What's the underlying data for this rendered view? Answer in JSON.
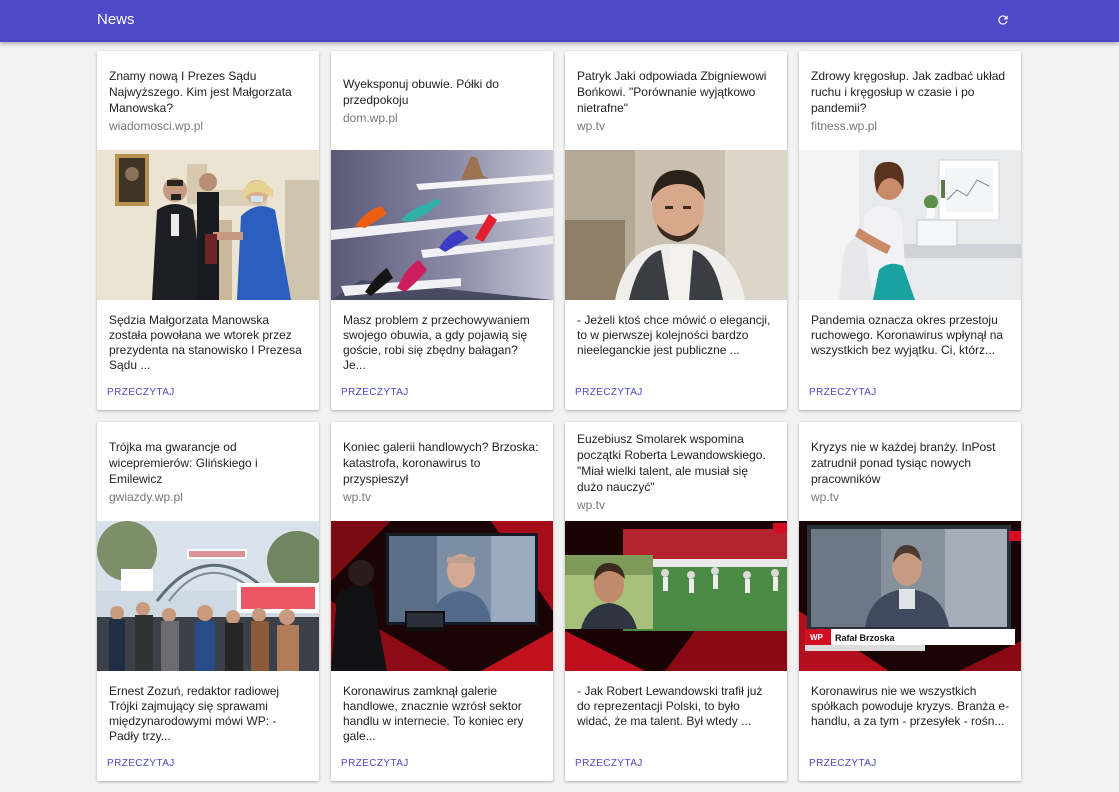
{
  "appbar": {
    "title": "News",
    "refresh_icon": "refresh-icon",
    "color": "#4e49c6"
  },
  "cards": [
    {
      "title": "Znamy nową I Prezes Sądu Najwyższego. Kim jest Małgorzata Manowska?",
      "source": "wiadomosci.wp.pl",
      "description": "Sędzia Małgorzata Manowska została powołana we wtorek przez prezydenta na stanowisko I Prezesa Sądu ...",
      "action": "PRZECZYTAJ",
      "image": "two-people-handshake-photo"
    },
    {
      "title": "Wyeksponuj obuwie. Półki do przedpokoju",
      "source": "dom.wp.pl",
      "description": "Masz problem z przechowywaniem swojego obuwia, a gdy pojawią się goście, robi się zbędny bałagan? Je...",
      "action": "PRZECZYTAJ",
      "image": "shoes-on-shelves-photo"
    },
    {
      "title": "Patryk Jaki odpowiada Zbigniewowi Bońkowi. \"Porównanie wyjątkowo nietrafne\"",
      "source": "wp.tv",
      "description": "- Jeżeli ktoś chce mówić o elegancji, to w pierwszej kolejności bardzo nieeleganckie jest publiczne ...",
      "action": "PRZECZYTAJ",
      "image": "man-interview-photo"
    },
    {
      "title": "Zdrowy kręgosłup. Jak zadbać układ ruchu i kręgosłup w czasie i po pandemii?",
      "source": "fitness.wp.pl",
      "description": "Pandemia oznacza okres przestoju ruchowego. Koronawirus wpłynął na wszystkich bez wyjątku. Ci, którz...",
      "action": "PRZECZYTAJ",
      "image": "woman-at-desk-photo"
    },
    {
      "title": "Trójka ma gwarancje od wicepremierów: Glińskiego i Emilewicz",
      "source": "gwiazdy.wp.pl",
      "description": "Ernest Zozuń, redaktor radiowej Trójki zajmujący się sprawami międzynarodowymi mówi WP: - Padły trzy...",
      "action": "PRZECZYTAJ",
      "image": "protest-crowd-photo"
    },
    {
      "title": "Koniec galerii handlowych? Brzoska: katastrofa, koronawirus to przyspieszył",
      "source": "wp.tv",
      "description": "Koronawirus zamknął galerie handlowe, znacznie wzrósł sektor handlu w internecie. To koniec ery gale...",
      "action": "PRZECZYTAJ",
      "image": "tv-studio-screen-photo"
    },
    {
      "title": "Euzebiusz Smolarek wspomina początki Roberta Lewandowskiego. \"Miał wielki talent, ale musiał się dużo nauczyć\"",
      "source": "wp.tv",
      "description": "- Jak Robert Lewandowski trafił już do reprezentacji Polski, to było widać, że ma talent. Był wtedy ...",
      "action": "PRZECZYTAJ",
      "image": "football-training-photo"
    },
    {
      "title": "Kryzys nie w każdej branży. InPost zatrudnił ponad tysiąc nowych pracowników",
      "source": "wp.tv",
      "description": "Koronawirus nie we wszystkich spółkach powoduje kryzys. Branża e-handlu, a za tym - przesyłek - rośn...",
      "action": "PRZECZYTAJ",
      "image": "video-call-photo",
      "caption": "Rafał Brzoska"
    }
  ]
}
